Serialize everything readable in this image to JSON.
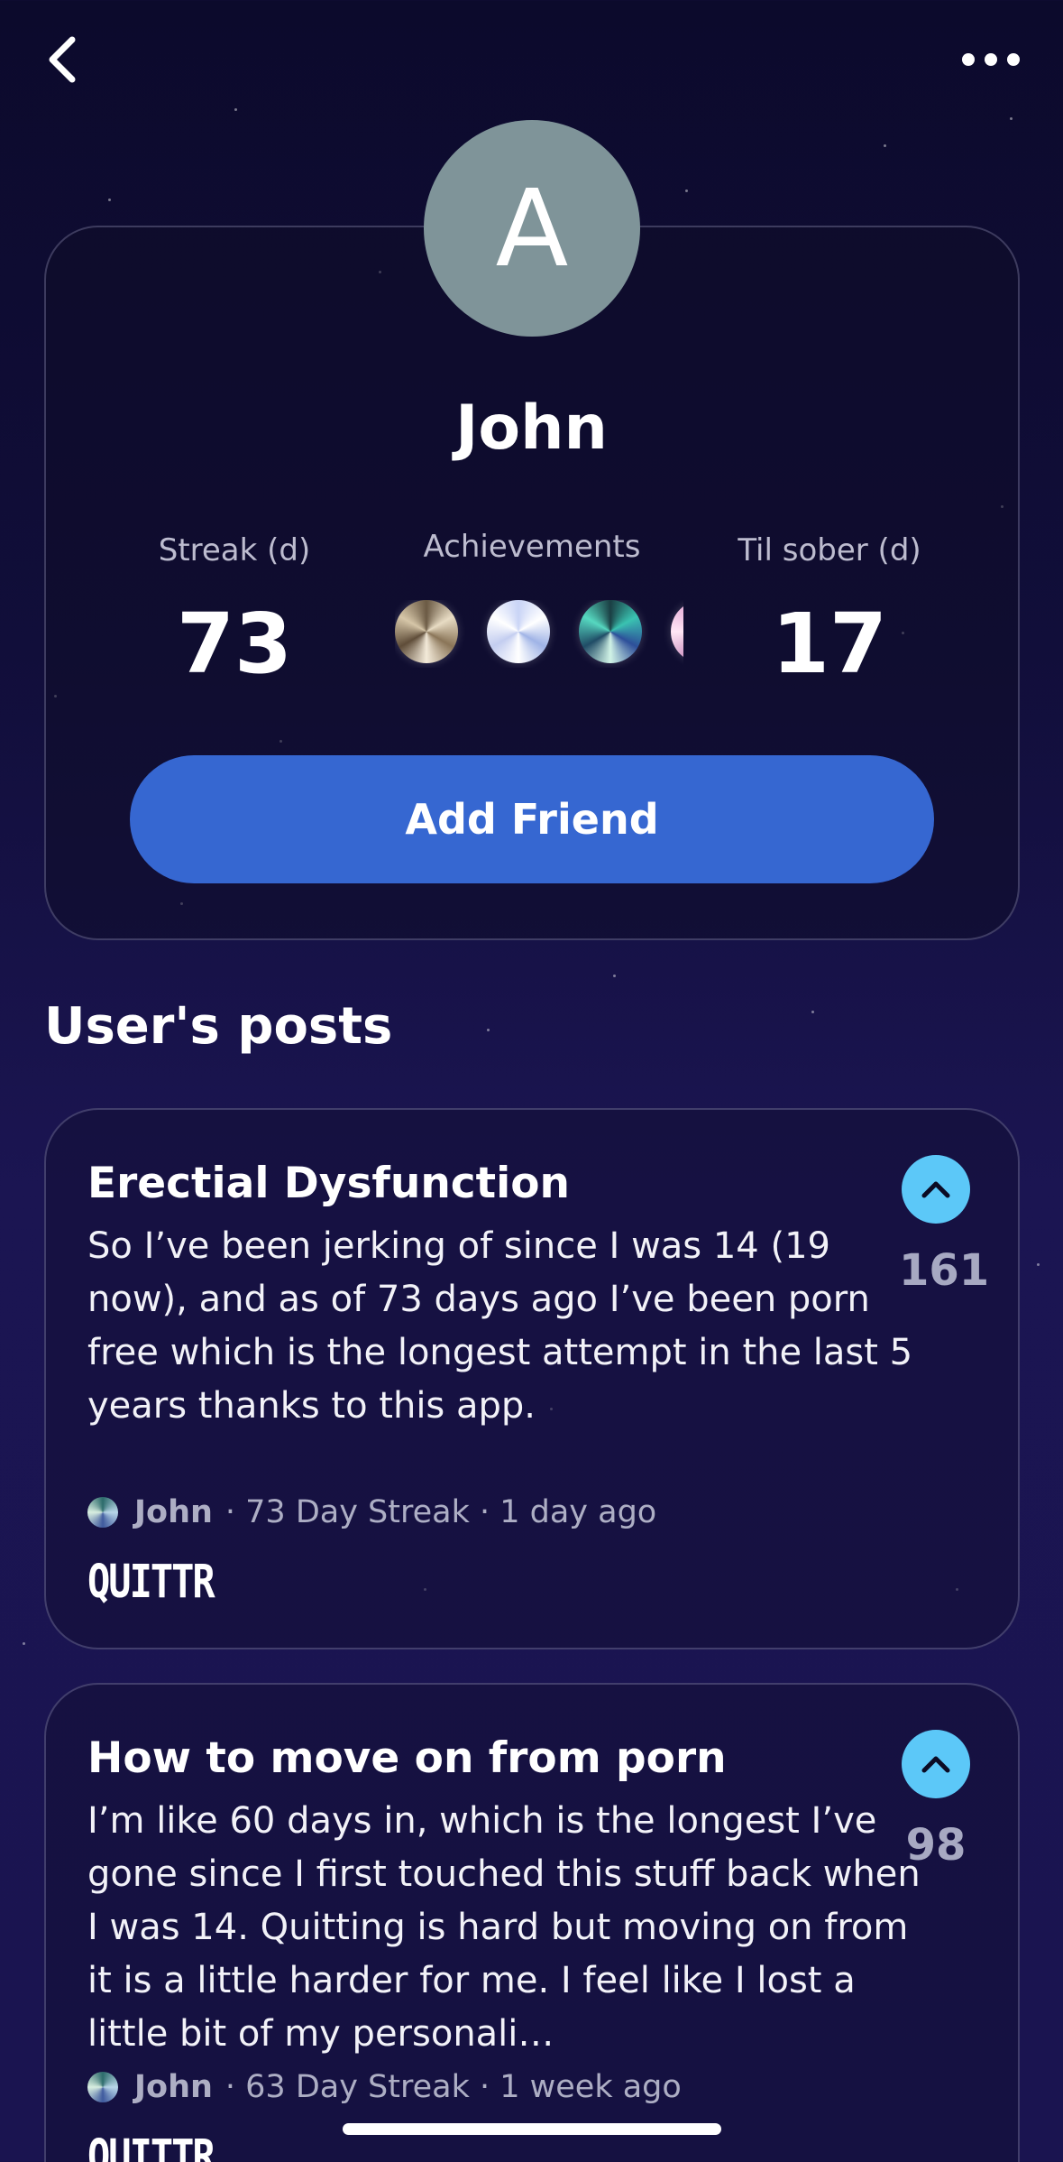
{
  "profile": {
    "avatar_letter": "A",
    "name": "John",
    "stats": {
      "streak_label": "Streak (d)",
      "streak_value": "73",
      "achievements_label": "Achievements",
      "sober_label": "Til sober (d)",
      "sober_value": "17"
    },
    "add_friend_label": "Add Friend"
  },
  "posts_section": {
    "title": "User's posts",
    "posts": [
      {
        "title": "Erectial Dysfunction",
        "body": "So I’ve been jerking of since I was 14 (19 now), and as of 73 days ago I’ve been porn free which is the longest attempt in the last 5 years thanks to this app.",
        "votes": "161",
        "author": "John",
        "details": "· 73 Day Streak · 1 day ago",
        "brand": "QUITTR"
      },
      {
        "title": "How to move on from porn",
        "body": "I’m like 60 days in, which is the longest I’ve gone since I first touched this stuff back when I was 14. Quitting is hard but moving on from it is a little harder for me. I feel like I lost a little bit of my personali…",
        "votes": "98",
        "author": "John",
        "details": "· 63 Day Streak · 1 week ago",
        "brand": "QUITTR"
      }
    ]
  },
  "icons": {
    "back": "chevron-left-icon",
    "more": "more-horizontal-icon",
    "upvote": "chevron-up-icon"
  },
  "colors": {
    "accent_button": "#3667d1",
    "upvote": "#5cc8f8",
    "avatar": "#7f9499"
  }
}
